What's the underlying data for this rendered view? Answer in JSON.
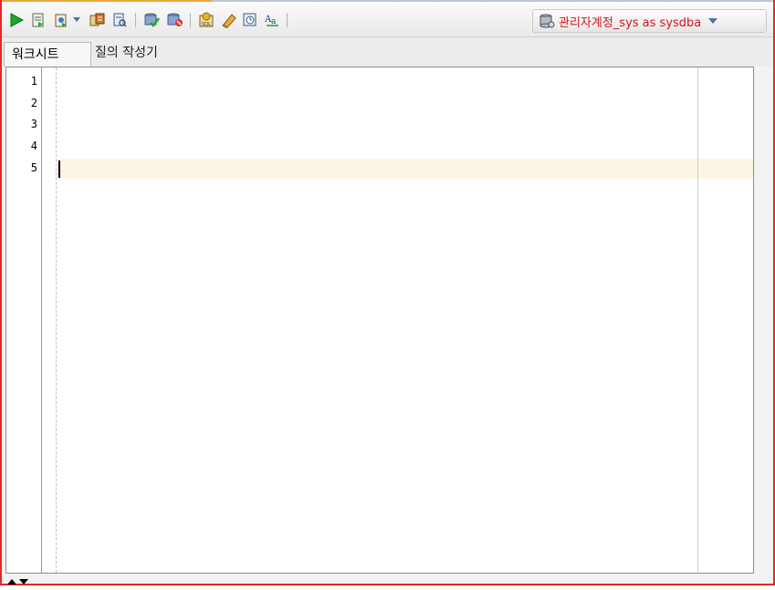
{
  "toolbar": {
    "buttons": [
      {
        "name": "run-statement-icon",
        "color": "#1fa52e"
      },
      {
        "name": "run-script-icon"
      },
      {
        "name": "autotrace-icon"
      },
      {
        "name": "dropdown-caret-icon"
      },
      {
        "name": "explain-plan-icon"
      },
      {
        "name": "sql-tuning-advisor-icon"
      },
      {
        "name": "commit-icon"
      },
      {
        "name": "rollback-icon"
      },
      {
        "name": "sql-history-icon"
      },
      {
        "name": "clear-icon"
      },
      {
        "name": "sql-history-panel-icon"
      },
      {
        "name": "to-upper-lower-icon"
      }
    ],
    "connection": {
      "label": "관리자계정_sys as sysdba",
      "color": "#d4141a"
    }
  },
  "tabs": [
    {
      "label": "워크시트",
      "active": true
    },
    {
      "label": "질의 작성기",
      "active": false
    }
  ],
  "editor": {
    "line_numbers": [
      "1",
      "2",
      "3",
      "4",
      "5"
    ],
    "current_line": 5,
    "current_line_color": "#fdf5e4"
  }
}
